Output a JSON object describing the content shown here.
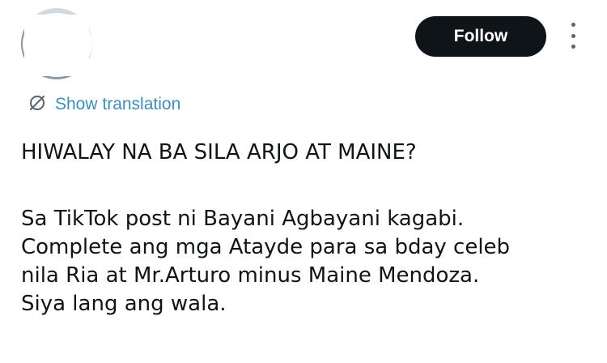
{
  "header": {
    "follow_label": "Follow",
    "more_icon": "more-vertical-icon"
  },
  "translation": {
    "icon": "translate-icon",
    "label": "Show translation"
  },
  "tweet": {
    "headline": "HIWALAY NA BA SILA ARJO AT MAINE?",
    "body_lines": [
      "Sa TikTok post ni Bayani Agbayani kagabi.",
      "Complete ang mga Atayde para sa bday celeb",
      "nila Ria at Mr.Arturo minus Maine Mendoza.",
      "Siya lang ang wala."
    ]
  },
  "colors": {
    "follow_bg": "#0f1419",
    "link": "#3b8fbf",
    "text": "#0f1419",
    "muted": "#536471"
  }
}
